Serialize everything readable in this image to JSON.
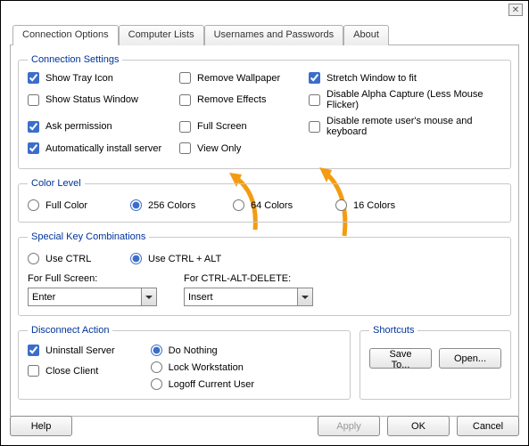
{
  "tabs": {
    "connection": "Connection Options",
    "computers": "Computer Lists",
    "users": "Usernames and Passwords",
    "about": "About"
  },
  "connectionSettings": {
    "legend": "Connection Settings",
    "showTray": "Show Tray Icon",
    "showStatus": "Show Status Window",
    "askPerm": "Ask permission",
    "autoInstall": "Automatically install server",
    "removeWallpaper": "Remove Wallpaper",
    "removeEffects": "Remove Effects",
    "fullScreen": "Full Screen",
    "viewOnly": "View Only",
    "stretch": "Stretch Window to fit",
    "disableAlpha": "Disable Alpha Capture (Less Mouse Flicker)",
    "disableRemote": "Disable remote user's mouse and keyboard"
  },
  "colorLevel": {
    "legend": "Color Level",
    "full": "Full Color",
    "c256": "256 Colors",
    "c64": "64 Colors",
    "c16": "16 Colors"
  },
  "specialKeys": {
    "legend": "Special Key Combinations",
    "ctrl": "Use CTRL",
    "ctrlAlt": "Use CTRL + ALT",
    "forFull": "For Full Screen:",
    "forCAD": "For CTRL-ALT-DELETE:",
    "fullValue": "Enter",
    "cadValue": "Insert"
  },
  "disconnect": {
    "legend": "Disconnect Action",
    "uninstall": "Uninstall Server",
    "closeClient": "Close Client",
    "doNothing": "Do Nothing",
    "lock": "Lock Workstation",
    "logoff": "Logoff Current User"
  },
  "shortcuts": {
    "legend": "Shortcuts",
    "saveTo": "Save To...",
    "open": "Open..."
  },
  "buttons": {
    "help": "Help",
    "apply": "Apply",
    "ok": "OK",
    "cancel": "Cancel"
  }
}
